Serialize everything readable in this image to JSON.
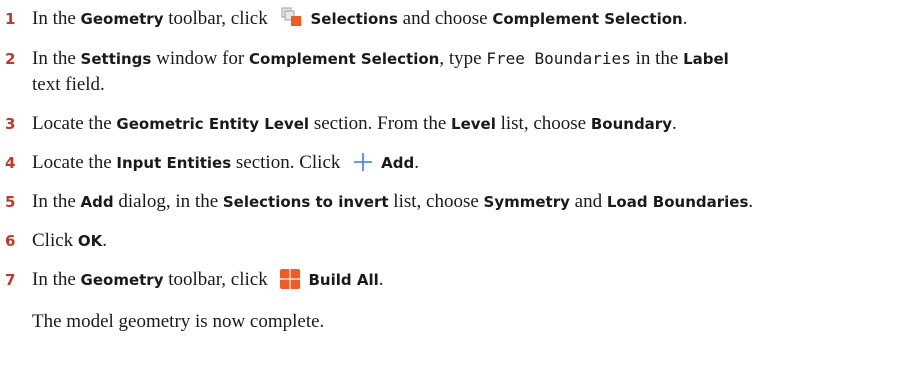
{
  "steps": [
    {
      "num": "1",
      "p1": "In the ",
      "b1": "Geometry",
      "p2": " toolbar, click ",
      "icon": "selections-icon",
      "b2": "Selections",
      "p3": " and choose ",
      "b3": "Complement Selection",
      "p4": "."
    },
    {
      "num": "2",
      "p1": "In the ",
      "b1": "Settings",
      "p2": " window for ",
      "b2": "Complement Selection",
      "p3": ", type ",
      "code": "Free Boundaries",
      "p4": " in the ",
      "b3": "Label",
      "line2": "text field."
    },
    {
      "num": "3",
      "p1": "Locate the ",
      "b1": "Geometric Entity Level",
      "p2": " section. From the ",
      "b2": "Level",
      "p3": " list, choose ",
      "b3": "Boundary",
      "p4": "."
    },
    {
      "num": "4",
      "p1": "Locate the ",
      "b1": "Input Entities",
      "p2": " section. Click ",
      "icon": "add-icon",
      "b2": "Add",
      "p3": "."
    },
    {
      "num": "5",
      "p1": "In the ",
      "b1": "Add",
      "p2": " dialog, in the ",
      "b2": "Selections to invert",
      "p3": " list, choose ",
      "b3": "Symmetry",
      "p4": " and ",
      "b4": "Load Boundaries",
      "p5": "."
    },
    {
      "num": "6",
      "p1": "Click ",
      "b1": "OK",
      "p2": "."
    },
    {
      "num": "7",
      "p1": "In the ",
      "b1": "Geometry",
      "p2": " toolbar, click ",
      "icon": "build-all-icon",
      "b2": "Build All",
      "p3": "."
    }
  ],
  "note": "The model geometry is now complete.",
  "colors": {
    "step_number": "#c0392b",
    "add_icon": "#3a7fd5",
    "build_icon": "#f05a24"
  }
}
